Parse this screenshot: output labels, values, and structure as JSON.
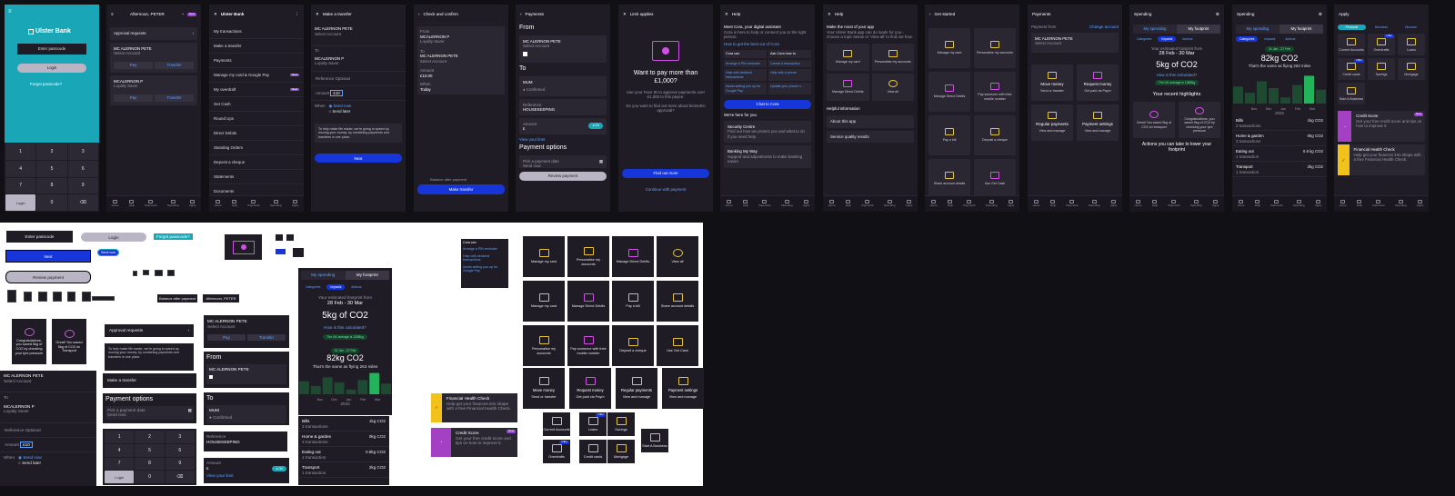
{
  "screens": {
    "s1": {
      "brand": "Ulster Bank",
      "passcode_placeholder": "Enter passcode",
      "login": "Login",
      "forgot": "Forgot passcode?",
      "keys": [
        "1",
        "2",
        "3",
        "4",
        "5",
        "6",
        "7",
        "8",
        "9",
        "Login",
        "0",
        "⌫"
      ]
    },
    "s2": {
      "greeting": "Afternoon, PETER",
      "approval": "Approval requests",
      "acc1_name": "MC ALERNON PETE",
      "acc1_type": "Select Account",
      "pay": "Pay",
      "transfer": "Transfer",
      "acc2_name": "MCALERNON P",
      "acc2_type": "Loyalty Saver"
    },
    "s3": {
      "brand": "Ulster Bank",
      "items": [
        "My transactions",
        "Make a transfer",
        "Payments",
        "Manage my card & Google Pay",
        "My overdraft",
        "Get Cash",
        "Round Ups",
        "Direct Debits",
        "Standing Orders",
        "Deposit a cheque",
        "Statements",
        "Documents"
      ],
      "new": "New"
    },
    "s4": {
      "title": "Make a transfer",
      "from_name": "MC ALERNON PETE",
      "from_type": "Select Account",
      "to_label": "To",
      "to_name": "MCALERNON P",
      "to_type": "Loyalty Saver",
      "ref_label": "Reference",
      "ref_value": "Optional",
      "amount_label": "Amount",
      "amount_value": "£10",
      "when_label": "When",
      "send_now": "Send now",
      "send_later": "Send later",
      "notice": "To help make life easier, we're going to speed up moving your money, by combining payments and transfers in one place.",
      "next": "Next"
    },
    "s5": {
      "title": "Check and confirm",
      "from_label": "From",
      "from_name": "MCALERNON P",
      "from_type": "Loyalty Saver",
      "to_label": "To",
      "to_name": "MC ALERNON PETE",
      "to_type": "Select Account",
      "amount_label": "Amount",
      "amount": "£10.00",
      "when_label": "When",
      "when": "Today",
      "balance": "Balance after payment",
      "make": "Make transfer"
    },
    "s6": {
      "title": "Payments",
      "from": "From",
      "from_name": "MC ALERNON PETE",
      "from_type": "Select Account",
      "to": "To",
      "payee": "MUM",
      "confirmed": "Confirmed",
      "ref_label": "Reference",
      "ref": "HOUSEKEEPING",
      "amount_label": "Amount",
      "amount": "£",
      "limit": "View your limit",
      "options": "Payment options",
      "date_label": "Pick a payment date",
      "date_val": "Send now",
      "review": "Review payment"
    },
    "s7": {
      "title": "Limit applies",
      "heading": "Want to pay more than £1,000?",
      "body": "Use your Face ID to approve payments over £1,000 to this payee.",
      "question": "Do you want to find out more about biometric approval?",
      "find": "Find out more",
      "cont": "Continue with payment"
    },
    "s8": {
      "title": "Help",
      "cora_title": "Meet Cora, your digital assistant",
      "cora_body": "Cora is here to help or connect you to the right person.",
      "cora_link": "How to get the best out of Cora",
      "chips": [
        "Cora can",
        "Ask Cora how to",
        "Arrange a PIN reminder",
        "Cancel a transaction",
        "Help with declined transactions",
        "Help with a phone",
        "Assist setting you up for Google Pay",
        "Update your phone n..."
      ],
      "chat": "Chat to Cora",
      "here": "We're here for you",
      "sec_title": "Security Centre",
      "sec_body": "Find out how we protect you and what to do if you need help.",
      "bank_title": "Banking My Way",
      "bank_body": "Support and adjustments to make banking easier."
    },
    "s9": {
      "title": "Help",
      "heading": "Make the most of your app",
      "body": "Your Ulster Bank app can do loads for you - choose a topic below or 'View all' to find out how.",
      "tiles": [
        "Manage my card",
        "Personalise my accounts",
        "Manage Direct Debits",
        "View all"
      ],
      "info": "Helpful information",
      "about": "About this app",
      "quality": "Service quality results"
    },
    "s10": {
      "title": "Get started",
      "tiles": [
        "Manage my card",
        "Personalise my accounts",
        "Manage Direct Debits",
        "Pay someone with their mobile number",
        "Pay a bill",
        "Deposit a cheque",
        "Share account details",
        "Use Get Cash"
      ]
    },
    "s11": {
      "title": "Payments",
      "from_label": "Payment from",
      "change": "Change account",
      "acc_name": "MC ALERNON PETE",
      "acc_type": "Select Account",
      "tiles": [
        {
          "t": "Move money",
          "s": "Send or transfer"
        },
        {
          "t": "Request money",
          "s": "Get paid via Paym"
        },
        {
          "t": "Regular payments",
          "s": "View and manage"
        },
        {
          "t": "Payment settings",
          "s": "View and manage"
        }
      ]
    },
    "s12": {
      "title": "Spending",
      "tab1": "My spending",
      "tab2": "My footprint",
      "chips": [
        "Categories",
        "Impacts",
        "Actions"
      ],
      "est": "Your estimated footprint from",
      "range": "28 Feb - 30 Mar",
      "co2": "5kg of CO2",
      "how": "How is this calculated?",
      "avg": "The UK average is 135Bkg",
      "highlights": "Your recent highlights",
      "h1": "Great! You saved 5kg of CO2 on transport",
      "h2": "Congratulations, you saved 5kg of CO2 by checking your tyre pressure",
      "actions": "Actions you can take to lower your footprint"
    },
    "s13": {
      "title": "Spending",
      "tab1": "My spending",
      "tab2": "My footprint",
      "chips": [
        "Categories",
        "Impacts",
        "Actions"
      ],
      "range": "31 Jan - 27 Feb",
      "co2": "82kg CO2",
      "miles": "That's the same as flying 263 miles",
      "months": [
        "Nov",
        "Dec",
        "Jan",
        "Feb",
        "Mar"
      ],
      "year": "2023",
      "cats": [
        {
          "n": "Bills",
          "c": "2 transactions",
          "v": "1kg CO2"
        },
        {
          "n": "Home & garden",
          "c": "3 transactions",
          "v": "0kg CO2"
        },
        {
          "n": "Eating out",
          "c": "1 transaction",
          "v": "0.8 kg CO2"
        },
        {
          "n": "Transport",
          "c": "1 transaction",
          "v": "2kg CO2"
        }
      ]
    },
    "s14": {
      "title": "Apply",
      "tabs": [
        "Personal",
        "Business",
        "Discover"
      ],
      "tiles": [
        "Current Accounts",
        "Overdrafts",
        "Loans",
        "Credit cards",
        "Savings",
        "Mortgage",
        "Start A Business"
      ],
      "offer": "Offer",
      "credit_title": "Credit Score",
      "credit_body": "Get your free credit score and tips on how to improve it.",
      "fhc_title": "Financial Health Check",
      "fhc_body": "Help get your finances into shape with a free Financial Health Check.",
      "new": "New"
    },
    "nav": [
      "Home",
      "Help",
      "Payments",
      "Spending",
      "Apply"
    ]
  },
  "sheet": {
    "passcode": "Enter passcode",
    "login": "Login",
    "forgot": "Forgot passcode?",
    "next": "Next",
    "review": "Review payment",
    "balance": "Balance after payment",
    "greeting": "Afternoon, PETER",
    "approval": "Approval requests",
    "notice": "To help make life easier, we're going to speed up moving your money, by combining payments and transfers in one place.",
    "make_transfer": "Make a transfer",
    "options": "Payment options",
    "date_label": "Pick a payment date",
    "date_val": "Send now",
    "cora_chips": [
      "Cora can",
      "Arrange a PIN reminder",
      "Help with declined transactions",
      "Assist setting you up for Google Pay"
    ],
    "from": "From",
    "to": "To",
    "payee": "MUM",
    "confirmed": "Confirmed",
    "ref_label": "Reference",
    "ref": "HOUSEKEEPING",
    "amount_label": "Amount",
    "amount": "£",
    "limit": "View your limit",
    "acc_name": "MC ALERNON PETE",
    "acc_type": "Select Account",
    "pay": "Pay",
    "transfer": "Transfer",
    "to_name": "MCALERNON P",
    "to_type": "Loyalty Saver",
    "ref_opt": "Optional",
    "amount_val": "£10",
    "when": "When",
    "send_now": "Send now",
    "send_later": "Send later",
    "keys": [
      "1",
      "2",
      "3",
      "4",
      "5",
      "6",
      "7",
      "8",
      "9",
      "Login",
      "0",
      "⌫"
    ],
    "h1": "Congratulations, you saved 5kg of CO2 by checking your tyre pressure",
    "h2": "Great! You saved 5kg of CO2 on Transport",
    "tab1": "My spending",
    "tab2": "My footprint",
    "chips": [
      "Categories",
      "Impacts",
      "Actions"
    ],
    "est": "Your estimated footprint from",
    "range": "28 Feb - 30 Mar",
    "co2": "5kg of CO2",
    "how": "How is this calculated?",
    "avg": "The UK average is 135Bkg",
    "range2": "31 Jan - 27 Feb",
    "co2b": "82kg CO2",
    "miles": "That's the same as flying 263 miles",
    "months": [
      "Nov",
      "Dec",
      "Jan",
      "Feb",
      "Mar"
    ],
    "year": "2023",
    "cats": [
      {
        "n": "Bills",
        "c": "2 transactions",
        "v": "1kg CO2"
      },
      {
        "n": "Home & garden",
        "c": "3 transactions",
        "v": "0kg CO2"
      },
      {
        "n": "Eating out",
        "c": "1 transaction",
        "v": "0.8kg CO2"
      },
      {
        "n": "Transport",
        "c": "1 transaction",
        "v": "2kg CO2"
      }
    ],
    "fhc_title": "Financial Health Check",
    "fhc_body": "Help get your finances into shape with a free Financial Health Check.",
    "credit_title": "Credit Score",
    "credit_body": "Get your free credit score and tips on how to improve it.",
    "new": "New",
    "grid": [
      "Manage my card",
      "Personalise my accounts",
      "Manage Direct Debits",
      "View all",
      "Manage my card",
      "Manage Direct Debits",
      "Pay a bill",
      "Share account details",
      "Personalise my accounts",
      "Pay someone with their mobile number",
      "Deposit a cheque",
      "Use Get Cash"
    ],
    "pay_tiles": [
      {
        "t": "Move money",
        "s": "Send or transfer"
      },
      {
        "t": "Request money",
        "s": "Get paid via Paym"
      },
      {
        "t": "Regular payments",
        "s": "View and manage"
      },
      {
        "t": "Payment settings",
        "s": "View and manage"
      }
    ],
    "apply_tiles": [
      "Current Accounts",
      "Loans",
      "Savings",
      "Overdrafts",
      "Credit cards",
      "Mortgage",
      "Start A Business"
    ],
    "offer": "Offer"
  },
  "colors": {
    "bg": "#1f1c26",
    "card": "#2a2733",
    "blue": "#1736d9",
    "teal": "#17a9b9",
    "purple": "#d24fe6",
    "yellow": "#e5c43c",
    "green": "#22b35b"
  }
}
